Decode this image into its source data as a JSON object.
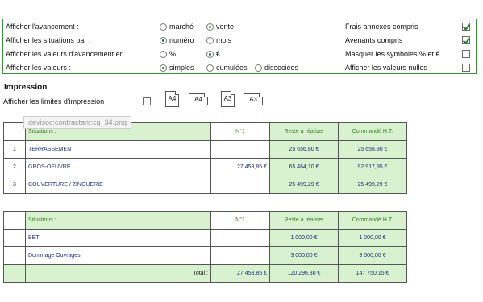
{
  "options": {
    "rows": [
      {
        "label": "Afficher l'avancement :",
        "choices": [
          {
            "label": "marché",
            "selected": false
          },
          {
            "label": "vente",
            "selected": true
          }
        ]
      },
      {
        "label": "Afficher les situations par :",
        "choices": [
          {
            "label": "numéro",
            "selected": true
          },
          {
            "label": "mois",
            "selected": false
          }
        ]
      },
      {
        "label": "Afficher les valeurs d'avancement en :",
        "choices": [
          {
            "label": "%",
            "selected": false
          },
          {
            "label": "€",
            "selected": true
          }
        ]
      },
      {
        "label": "Afficher les valeurs :",
        "choices": [
          {
            "label": "simples",
            "selected": true
          },
          {
            "label": "cumulées",
            "selected": false
          },
          {
            "label": "dissociées",
            "selected": false
          }
        ]
      }
    ],
    "checkboxes": [
      {
        "label": "Frais annexes compris",
        "checked": true
      },
      {
        "label": "Avenants compris",
        "checked": true
      },
      {
        "label": "Masquer les symboles % et €",
        "checked": false
      },
      {
        "label": "Afficher les valeurs nulles",
        "checked": false
      }
    ]
  },
  "impression": {
    "title": "Impression",
    "limits_label": "Afficher les limites d'impression",
    "limits_checked": false,
    "formats": [
      "A4",
      "A4",
      "A3",
      "A3"
    ]
  },
  "tooltip": "devisoc:contractant:cg_34.png",
  "table1": {
    "headers": [
      "Situations :",
      "N°1",
      "Reste à réaliser",
      "Commandé H.T."
    ],
    "rows": [
      {
        "num": "1",
        "name": "TERRASSEMENT",
        "n1": "",
        "reste": "25 656,80 €",
        "commande": "25 656,80 €"
      },
      {
        "num": "2",
        "name": "GROS-OEUVRE",
        "n1": "27 453,85 €",
        "reste": "65 464,10 €",
        "commande": "92 917,95 €"
      },
      {
        "num": "3",
        "name": "COUVERTURE / ZINGUERIE",
        "n1": "",
        "reste": "25 499,29 €",
        "commande": "25 499,29 €"
      }
    ]
  },
  "table2": {
    "headers": [
      "Situations :",
      "N°1",
      "Reste à réaliser",
      "Commandé H.T."
    ],
    "rows": [
      {
        "name": "BET",
        "n1": "",
        "reste": "1 000,00 €",
        "commande": "1 000,00 €"
      },
      {
        "name": "Dommage Ouvrages",
        "n1": "",
        "reste": "3 000,00 €",
        "commande": "3 000,00 €"
      }
    ],
    "total": {
      "label": "Total :",
      "n1": "27 453,85 €",
      "reste": "120 296,30 €",
      "commande": "147 750,15 €"
    }
  }
}
